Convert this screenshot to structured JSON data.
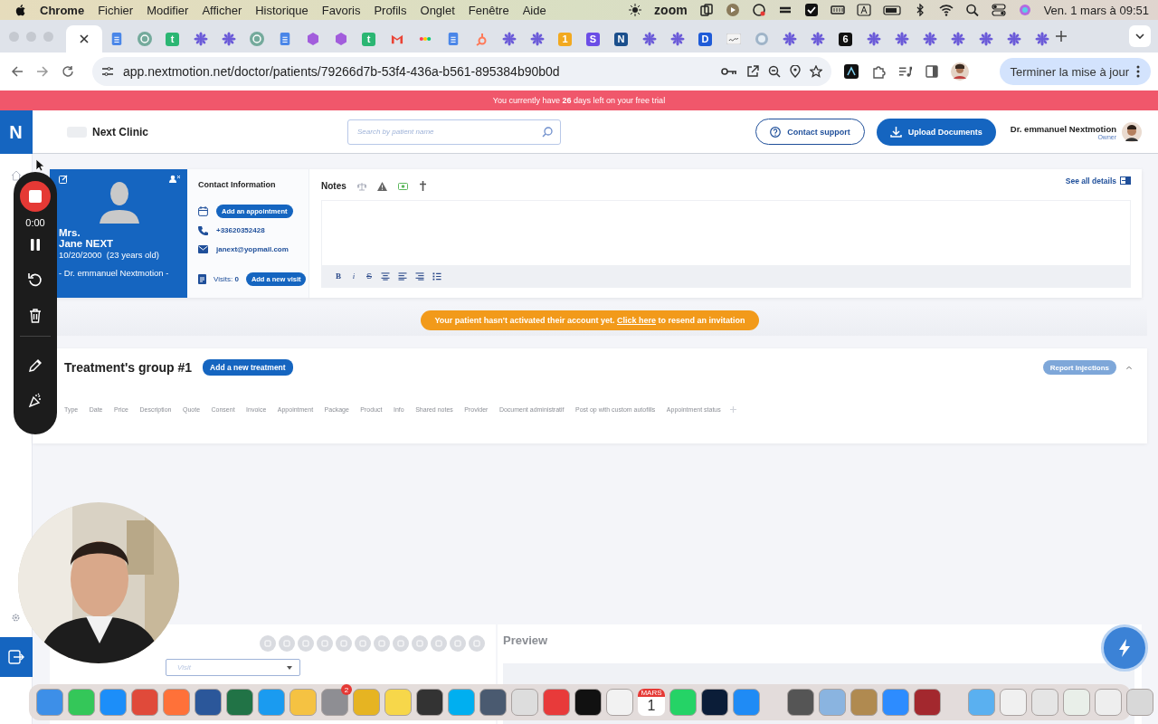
{
  "menu_bar": {
    "app": "Chrome",
    "items": [
      "Fichier",
      "Modifier",
      "Afficher",
      "Historique",
      "Favoris",
      "Profils",
      "Onglet",
      "Fenêtre",
      "Aide"
    ],
    "zoom_label": "zoom",
    "clock": "Ven. 1 mars à 09:51"
  },
  "browser": {
    "tabs": [
      {
        "kind": "blank",
        "selected": true
      },
      {
        "kind": "doc",
        "selected": false
      },
      {
        "kind": "gpt",
        "selected": false
      },
      {
        "kind": "letter",
        "glyph": "t",
        "color": "#2bb673",
        "selected": false
      },
      {
        "kind": "flower",
        "selected": false
      },
      {
        "kind": "flower",
        "selected": false
      },
      {
        "kind": "gpt",
        "selected": false
      },
      {
        "kind": "doc",
        "selected": false
      },
      {
        "kind": "hex",
        "selected": false
      },
      {
        "kind": "hex",
        "selected": false
      },
      {
        "kind": "letter",
        "glyph": "t",
        "color": "#2bb673",
        "selected": false
      },
      {
        "kind": "gmail",
        "selected": false
      },
      {
        "kind": "monday",
        "selected": false
      },
      {
        "kind": "doc",
        "selected": false
      },
      {
        "kind": "hubspot",
        "selected": false
      },
      {
        "kind": "flower",
        "selected": false
      },
      {
        "kind": "flower",
        "selected": false
      },
      {
        "kind": "letter",
        "glyph": "1",
        "color": "#f2a91f",
        "selected": false
      },
      {
        "kind": "letter",
        "glyph": "S",
        "color": "#6b4de6",
        "selected": false
      },
      {
        "kind": "letter",
        "glyph": "N",
        "color": "#1b4f8c",
        "selected": false
      },
      {
        "kind": "flower",
        "selected": false
      },
      {
        "kind": "flower",
        "selected": false
      },
      {
        "kind": "letter",
        "glyph": "D",
        "color": "#1e5bd8",
        "selected": false
      },
      {
        "kind": "sig",
        "selected": false
      },
      {
        "kind": "globe",
        "selected": false
      },
      {
        "kind": "flower",
        "selected": false
      },
      {
        "kind": "flower",
        "selected": false
      },
      {
        "kind": "letter",
        "glyph": "6",
        "color": "#111111",
        "selected": false
      },
      {
        "kind": "flower",
        "selected": false
      },
      {
        "kind": "flower",
        "selected": false
      },
      {
        "kind": "flower",
        "selected": false
      },
      {
        "kind": "flower",
        "selected": false
      },
      {
        "kind": "flower",
        "selected": false
      },
      {
        "kind": "flower",
        "selected": false
      },
      {
        "kind": "flower",
        "selected": false
      }
    ],
    "url": "app.nextmotion.net/doctor/patients/79266d7b-53f4-436a-b561-895384b90b0d",
    "update_button": "Terminer la mise à jour"
  },
  "trial_banner": "You currently have **26** days left on your free trial",
  "header": {
    "logo": "N",
    "clinic": "Next Clinic",
    "search": {
      "placeholder": "Search by patient name"
    },
    "contact_button": "Contact support",
    "upload_button": "Upload Documents",
    "user": {
      "name": "Dr. emmanuel Nextmotion",
      "role": "Owner"
    }
  },
  "patient": {
    "title": "Mrs.",
    "name": "Jane NEXT",
    "birth": "10/20/2000  (23 years old)",
    "doctor": "- Dr. emmanuel Nextmotion -"
  },
  "contact": {
    "heading": "Contact Information",
    "appointment_button": "Add an appointment",
    "phone": "+33620352428",
    "email": "janext@yopmail.com",
    "visits": "Visits: **0**",
    "visit_button": "Add a new visit"
  },
  "notes": {
    "heading": "Notes",
    "see_all": "See all details",
    "toolbar": [
      {
        "kind": "bold",
        "glyph": "B"
      },
      {
        "kind": "italic",
        "glyph": "i"
      },
      {
        "kind": "strike",
        "glyph": "S"
      },
      {
        "kind": "center"
      },
      {
        "kind": "left"
      },
      {
        "kind": "right"
      },
      {
        "kind": "list"
      }
    ]
  },
  "activation_alert": {
    "before": "Your patient hasn't activated their account yet. ",
    "link": "Click here",
    "after": " to resend an invitation"
  },
  "treatment_group": {
    "title": "Treatment's group #1",
    "add_button": "Add a new treatment",
    "report_button": "Report Injections",
    "expanded": true,
    "columns": [
      "Type",
      "Date",
      "Price",
      "Description",
      "Quote",
      "Consent",
      "Invoice",
      "Appointment",
      "Package",
      "Product",
      "Info",
      "Shared notes",
      "Provider",
      "Document administratif",
      "Post op with custom autofills",
      "Appointment status"
    ]
  },
  "composer": {
    "visit_select": {
      "placeholder": "Visit"
    },
    "preview_title": "Preview"
  },
  "recorder": {
    "timer": "0:00"
  },
  "dock": [
    {
      "kind": "app",
      "color": "#3d8fe8"
    },
    {
      "kind": "app",
      "color": "#34c759"
    },
    {
      "kind": "app",
      "color": "#1c8ef9"
    },
    {
      "kind": "app",
      "color": "#e04a3a"
    },
    {
      "kind": "app",
      "color": "#ff7139"
    },
    {
      "kind": "app",
      "color": "#2b579a"
    },
    {
      "kind": "app",
      "color": "#217346"
    },
    {
      "kind": "app",
      "color": "#1a9bf0"
    },
    {
      "kind": "app",
      "color": "#f5c242"
    },
    {
      "kind": "app",
      "color": "#8e8e93",
      "badge": "2"
    },
    {
      "kind": "app",
      "color": "#e6b422"
    },
    {
      "kind": "app",
      "color": "#f7d74a"
    },
    {
      "kind": "app",
      "color": "#333333"
    },
    {
      "kind": "app",
      "color": "#00aff0"
    },
    {
      "kind": "app",
      "color": "#4a5a70"
    },
    {
      "kind": "app",
      "color": "#dddddd"
    },
    {
      "kind": "app",
      "color": "#e83a3a"
    },
    {
      "kind": "app",
      "color": "#111111"
    },
    {
      "kind": "app",
      "color": "#f2f2f2"
    },
    {
      "kind": "calendar",
      "month": "MARS",
      "day": "1"
    },
    {
      "kind": "app",
      "color": "#25d366"
    },
    {
      "kind": "app",
      "color": "#0b1d38"
    },
    {
      "kind": "app",
      "color": "#1f8bf5"
    },
    {
      "kind": "separator"
    },
    {
      "kind": "app",
      "color": "#555555"
    },
    {
      "kind": "app",
      "color": "#8ab4e0"
    },
    {
      "kind": "app",
      "color": "#b08a50"
    },
    {
      "kind": "app",
      "color": "#2d8cff"
    },
    {
      "kind": "app",
      "color": "#a3282e"
    },
    {
      "kind": "separator"
    },
    {
      "kind": "app",
      "color": "#5ab0f0"
    },
    {
      "kind": "app",
      "color": "#f0f0f0"
    },
    {
      "kind": "app",
      "color": "#e5e5e5"
    },
    {
      "kind": "app",
      "color": "#e9efe9"
    },
    {
      "kind": "app",
      "color": "#eeeeee"
    },
    {
      "kind": "app",
      "color": "#d8d8d8"
    }
  ]
}
